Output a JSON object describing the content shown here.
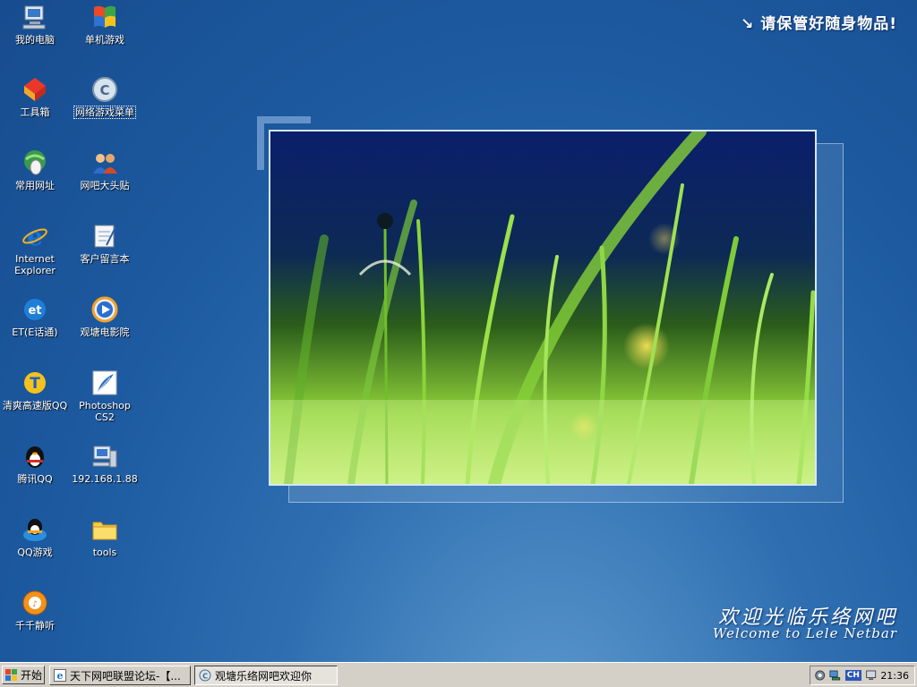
{
  "desktop": {
    "notice": "↘ 请保管好随身物品!",
    "welcome_cn": "欢迎光临乐络网吧",
    "welcome_en": "Welcome to Lele Netbar",
    "icons": [
      {
        "label": "我的电脑"
      },
      {
        "label": "单机游戏"
      },
      {
        "label": "工具箱"
      },
      {
        "label": "网络游戏菜单"
      },
      {
        "label": "常用网址"
      },
      {
        "label": "网吧大头贴"
      },
      {
        "label": "Internet Explorer"
      },
      {
        "label": "客户留言本"
      },
      {
        "label": "ET(E话通)"
      },
      {
        "label": "观塘电影院"
      },
      {
        "label": "清爽高速版QQ"
      },
      {
        "label": "Photoshop CS2"
      },
      {
        "label": "腾讯QQ"
      },
      {
        "label": "192.168.1.88"
      },
      {
        "label": "QQ游戏"
      },
      {
        "label": "tools"
      },
      {
        "label": "千千静听"
      }
    ]
  },
  "taskbar": {
    "start_label": "开始",
    "tasks": [
      {
        "label": "天下网吧联盟论坛-【..."
      },
      {
        "label": "观塘乐络网吧欢迎你"
      }
    ],
    "tray": {
      "input_indicator": "CH",
      "clock": "21:36"
    }
  },
  "colors": {
    "desktop_blue": "#1d5aa0",
    "taskbar": "#d4d0c8"
  }
}
